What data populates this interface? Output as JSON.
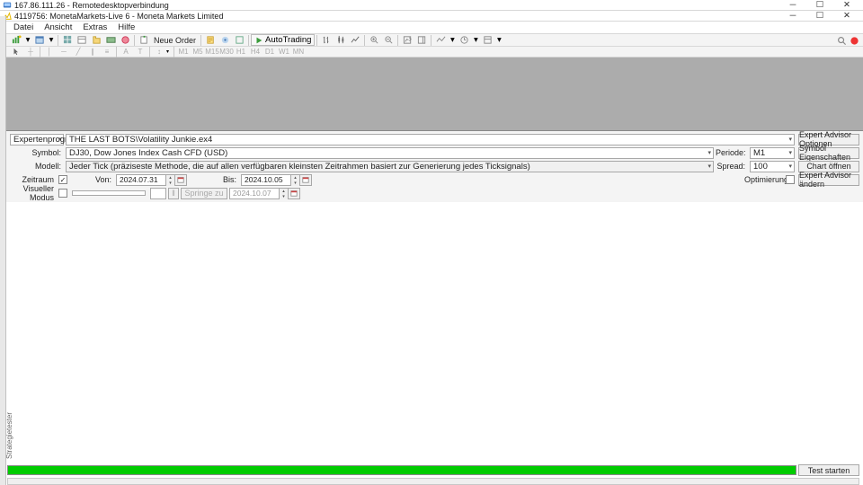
{
  "outer": {
    "title": "167.86.111.26 - Remotedesktopverbindung"
  },
  "inner": {
    "title": "4119756: MonetaMarkets-Live 6 - Moneta Markets Limited"
  },
  "menu": {
    "file": "Datei",
    "view": "Ansicht",
    "extras": "Extras",
    "help": "Hilfe"
  },
  "toolbar": {
    "neworder": "Neue Order",
    "autotrade": "AutoTrading"
  },
  "tf": [
    "M1",
    "M5",
    "M15",
    "M30",
    "H1",
    "H4",
    "D1",
    "W1",
    "MN"
  ],
  "tester": {
    "category_label": "Expertenprogramm",
    "expert": "THE LAST BOTS\\Volatility Junkie.ex4",
    "symbol_label": "Symbol:",
    "symbol": "DJ30, Dow Jones Index Cash CFD (USD)",
    "model_label": "Modell:",
    "model": "Jeder Tick (präziseste Methode, die auf allen verfügbaren kleinsten Zeitrahmen basiert zur Generierung jedes Ticksignals)",
    "period_label": "Periode:",
    "period": "M1",
    "spread_label": "Spread:",
    "spread": "100",
    "timerange_label": "Zeitraum",
    "from_label": "Von:",
    "from": "2024.07.31",
    "to_label": "Bis:",
    "to": "2024.10.05",
    "visual_label": "Visueller Modus",
    "jump_label": "Springe zu",
    "jump_date": "2024.10.07",
    "optim_label": "Optimierung",
    "btn_ea_options": "Expert Advisor Optionen",
    "btn_sym_props": "Symbol Eigenschaften",
    "btn_open_chart": "Chart öffnen",
    "btn_ea_edit": "Expert Advisor ändern",
    "btn_start": "Test starten"
  },
  "side": {
    "tester": "Strategietester"
  }
}
